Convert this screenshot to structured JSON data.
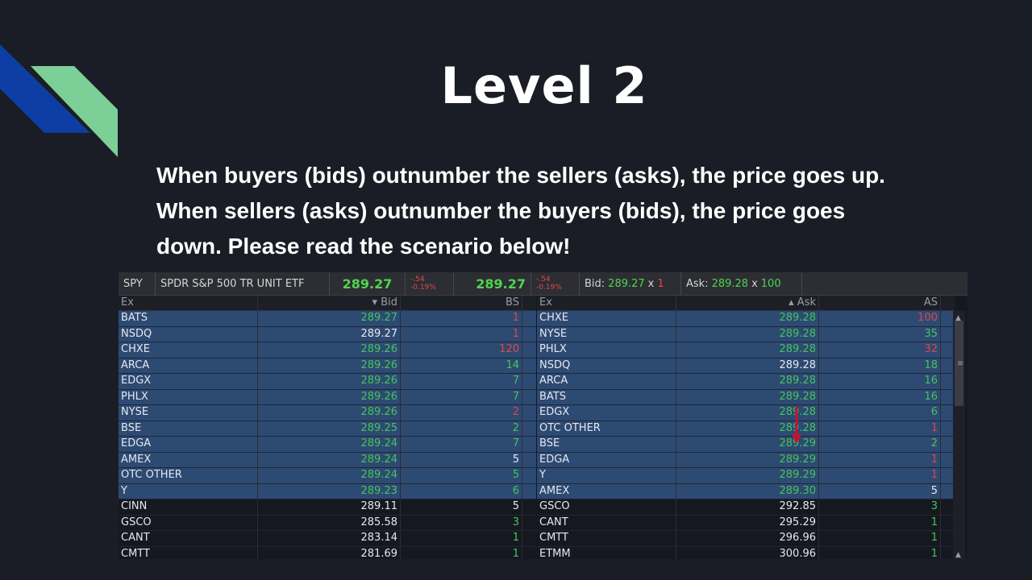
{
  "slide": {
    "title": "Level 2",
    "lines": [
      "When buyers (bids) outnumber the sellers (asks), the price goes up.",
      "When sellers (asks) outnumber the buyers (bids), the price goes",
      "down.  Please read the scenario below!"
    ]
  },
  "colors": {
    "background": "#1b1d26",
    "deco_blue": "#0d3ea3",
    "deco_green": "#7ccf97",
    "bid_up": "#4fd44f",
    "down": "#e04848",
    "row_highlight": "#2d4a73"
  },
  "header": {
    "symbol": "SPY",
    "name": "SPDR S&P 500 TR UNIT ETF",
    "last_bid": "289.27",
    "chg1": "-.54",
    "pct1": "-0.19%",
    "last_ask": "289.27",
    "chg2": "-.54",
    "pct2": "-0.19%",
    "bid_label": "Bid:",
    "bid_price": "289.27",
    "bid_x": "x",
    "bid_size": "1",
    "ask_label": "Ask:",
    "ask_price": "289.28",
    "ask_x": "x",
    "ask_size": "100"
  },
  "bids": {
    "headers": {
      "ex": "Ex",
      "price": "Bid",
      "size": "BS"
    },
    "rows": [
      {
        "ex": "BATS",
        "price": "289.27",
        "size": "1",
        "hl": true,
        "pc": "green",
        "sc": "red"
      },
      {
        "ex": "NSDQ",
        "price": "289.27",
        "size": "1",
        "hl": true,
        "pc": "white",
        "sc": "red"
      },
      {
        "ex": "CHXE",
        "price": "289.26",
        "size": "120",
        "hl": true,
        "pc": "green",
        "sc": "red"
      },
      {
        "ex": "ARCA",
        "price": "289.26",
        "size": "14",
        "hl": true,
        "pc": "green",
        "sc": "green"
      },
      {
        "ex": "EDGX",
        "price": "289.26",
        "size": "7",
        "hl": true,
        "pc": "green",
        "sc": "green"
      },
      {
        "ex": "PHLX",
        "price": "289.26",
        "size": "7",
        "hl": true,
        "pc": "green",
        "sc": "green"
      },
      {
        "ex": "NYSE",
        "price": "289.26",
        "size": "2",
        "hl": true,
        "pc": "green",
        "sc": "red"
      },
      {
        "ex": "BSE",
        "price": "289.25",
        "size": "2",
        "hl": true,
        "pc": "green",
        "sc": "green"
      },
      {
        "ex": "EDGA",
        "price": "289.24",
        "size": "7",
        "hl": true,
        "pc": "green",
        "sc": "green"
      },
      {
        "ex": "AMEX",
        "price": "289.24",
        "size": "5",
        "hl": true,
        "pc": "green",
        "sc": "white"
      },
      {
        "ex": "OTC OTHER",
        "price": "289.24",
        "size": "5",
        "hl": true,
        "pc": "green",
        "sc": "green"
      },
      {
        "ex": "Y",
        "price": "289.23",
        "size": "6",
        "hl": true,
        "pc": "green",
        "sc": "green"
      },
      {
        "ex": "CINN",
        "price": "289.11",
        "size": "5",
        "hl": false,
        "pc": "white",
        "sc": "white"
      },
      {
        "ex": "GSCO",
        "price": "285.58",
        "size": "3",
        "hl": false,
        "pc": "white",
        "sc": "green"
      },
      {
        "ex": "CANT",
        "price": "283.14",
        "size": "1",
        "hl": false,
        "pc": "white",
        "sc": "green"
      },
      {
        "ex": "CMTT",
        "price": "281.69",
        "size": "1",
        "hl": false,
        "pc": "white",
        "sc": "green"
      }
    ]
  },
  "asks": {
    "headers": {
      "ex": "Ex",
      "price": "Ask",
      "size": "AS"
    },
    "rows": [
      {
        "ex": "CHXE",
        "price": "289.28",
        "size": "100",
        "hl": true,
        "pc": "green",
        "sc": "red"
      },
      {
        "ex": "NYSE",
        "price": "289.28",
        "size": "35",
        "hl": true,
        "pc": "green",
        "sc": "green"
      },
      {
        "ex": "PHLX",
        "price": "289.28",
        "size": "32",
        "hl": true,
        "pc": "green",
        "sc": "red"
      },
      {
        "ex": "NSDQ",
        "price": "289.28",
        "size": "18",
        "hl": true,
        "pc": "white",
        "sc": "green"
      },
      {
        "ex": "ARCA",
        "price": "289.28",
        "size": "16",
        "hl": true,
        "pc": "green",
        "sc": "green"
      },
      {
        "ex": "BATS",
        "price": "289.28",
        "size": "16",
        "hl": true,
        "pc": "green",
        "sc": "green"
      },
      {
        "ex": "EDGX",
        "price": "289.28",
        "size": "6",
        "hl": true,
        "pc": "green",
        "sc": "green"
      },
      {
        "ex": "OTC OTHER",
        "price": "289.28",
        "size": "1",
        "hl": true,
        "pc": "green",
        "sc": "red"
      },
      {
        "ex": "BSE",
        "price": "289.29",
        "size": "2",
        "hl": true,
        "pc": "green",
        "sc": "green"
      },
      {
        "ex": "EDGA",
        "price": "289.29",
        "size": "1",
        "hl": true,
        "pc": "green",
        "sc": "red"
      },
      {
        "ex": "Y",
        "price": "289.29",
        "size": "1",
        "hl": true,
        "pc": "green",
        "sc": "red"
      },
      {
        "ex": "AMEX",
        "price": "289.30",
        "size": "5",
        "hl": true,
        "pc": "green",
        "sc": "white"
      },
      {
        "ex": "GSCO",
        "price": "292.85",
        "size": "3",
        "hl": false,
        "pc": "white",
        "sc": "green"
      },
      {
        "ex": "CANT",
        "price": "295.29",
        "size": "1",
        "hl": false,
        "pc": "white",
        "sc": "green"
      },
      {
        "ex": "CMTT",
        "price": "296.96",
        "size": "1",
        "hl": false,
        "pc": "white",
        "sc": "green"
      },
      {
        "ex": "ETMM",
        "price": "300.96",
        "size": "1",
        "hl": false,
        "pc": "white",
        "sc": "green"
      }
    ]
  }
}
